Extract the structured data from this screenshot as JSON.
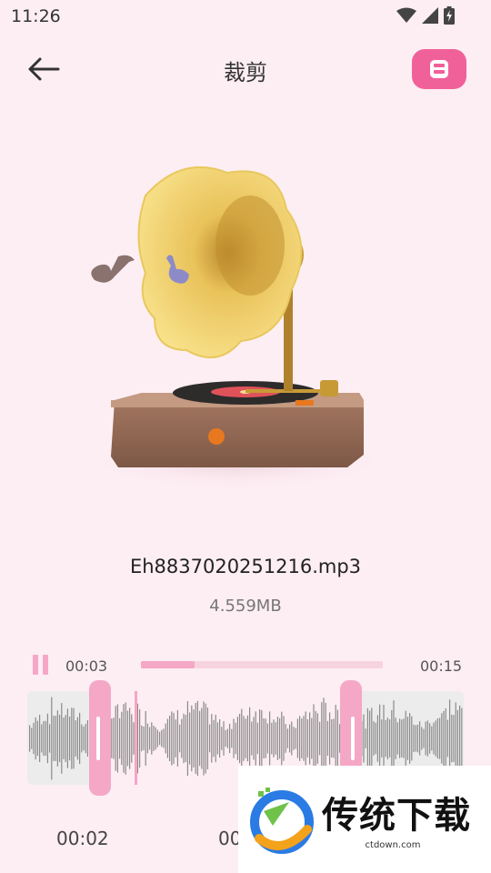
{
  "status_bar": {
    "time": "11:26",
    "icons": [
      "wifi-icon",
      "signal-icon",
      "battery-charging-icon"
    ]
  },
  "header": {
    "title": "裁剪",
    "back_icon": "arrow-left-icon",
    "save_icon": "save-icon"
  },
  "colors": {
    "background": "#fdeef3",
    "accent": "#f0619a",
    "accent_light": "#f5a7c6",
    "waveform": "#8a8a8a"
  },
  "file": {
    "name": "Eh8837020251216.mp3",
    "size": "4.559MB"
  },
  "player": {
    "state_icon": "pause-icon",
    "current_time": "00:03",
    "total_time": "00:15",
    "progress": 0.22
  },
  "trim": {
    "start_time": "00:02",
    "end_time": "00",
    "selection_start": 0.15,
    "selection_end": 0.74,
    "playhead": 0.2
  },
  "watermark": {
    "brand": "传统下载",
    "url": "ctdown.com"
  }
}
